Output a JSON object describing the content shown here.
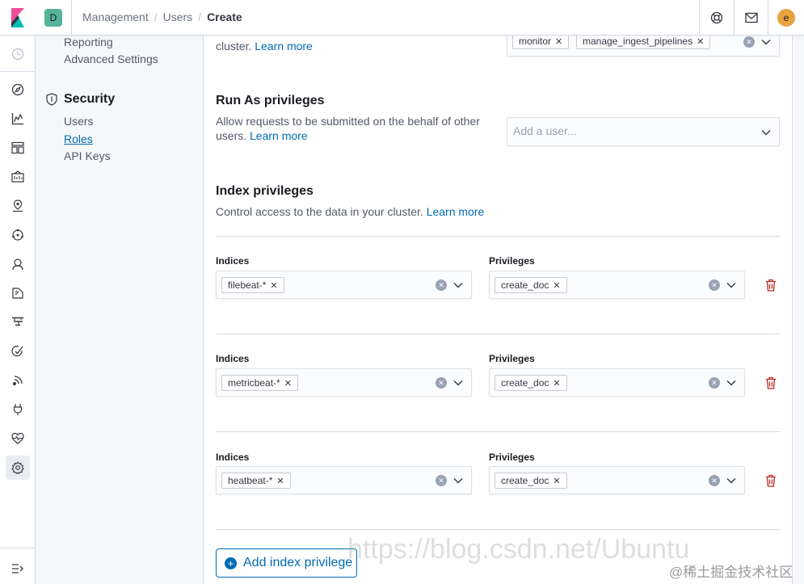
{
  "header": {
    "space_initial": "D",
    "breadcrumbs": [
      "Management",
      "Users",
      "Create"
    ],
    "avatar_initial": "e",
    "icons": [
      "help-icon",
      "newsfeed-icon"
    ]
  },
  "iconnav": {
    "items": [
      "recently-viewed-icon",
      "discover-icon",
      "visualize-icon",
      "dashboard-icon",
      "canvas-icon",
      "maps-icon",
      "ml-icon",
      "infrastructure-icon",
      "logs-icon",
      "apm-icon",
      "uptime-icon",
      "siem-icon",
      "dev-tools-icon",
      "monitoring-icon",
      "management-icon"
    ],
    "collapse": "dock-icon"
  },
  "sidebar": {
    "reporting": "Reporting",
    "advanced_settings": "Advanced Settings",
    "security_title": "Security",
    "users": "Users",
    "roles": "Roles",
    "api_keys": "API Keys"
  },
  "cluster": {
    "desc_partial_prefix": "cluster.",
    "learn_more": "Learn more",
    "pills": [
      "monitor",
      "manage_ingest_pipelines"
    ]
  },
  "run_as": {
    "title": "Run As privileges",
    "desc_line1": "Allow requests to be submitted on the behalf of other",
    "desc_line2_prefix": "users.",
    "learn_more": "Learn more",
    "placeholder": "Add a user..."
  },
  "index_privileges": {
    "title": "Index privileges",
    "desc": "Control access to the data in your cluster.",
    "learn_more": "Learn more",
    "indices_label": "Indices",
    "privileges_label": "Privileges",
    "rows": [
      {
        "index": "filebeat-*",
        "privilege": "create_doc"
      },
      {
        "index": "metricbeat-*",
        "privilege": "create_doc"
      },
      {
        "index": "heatbeat-*",
        "privilege": "create_doc"
      }
    ],
    "add_button": "Add index privilege"
  },
  "watermark": {
    "url": "https://blog.csdn.net/Ubuntu",
    "site": "@稀土掘金技术社区"
  },
  "colors": {
    "accent": "#006bb4",
    "danger": "#bd271e",
    "space": "#54b399",
    "avatar": "#e7a33e"
  }
}
